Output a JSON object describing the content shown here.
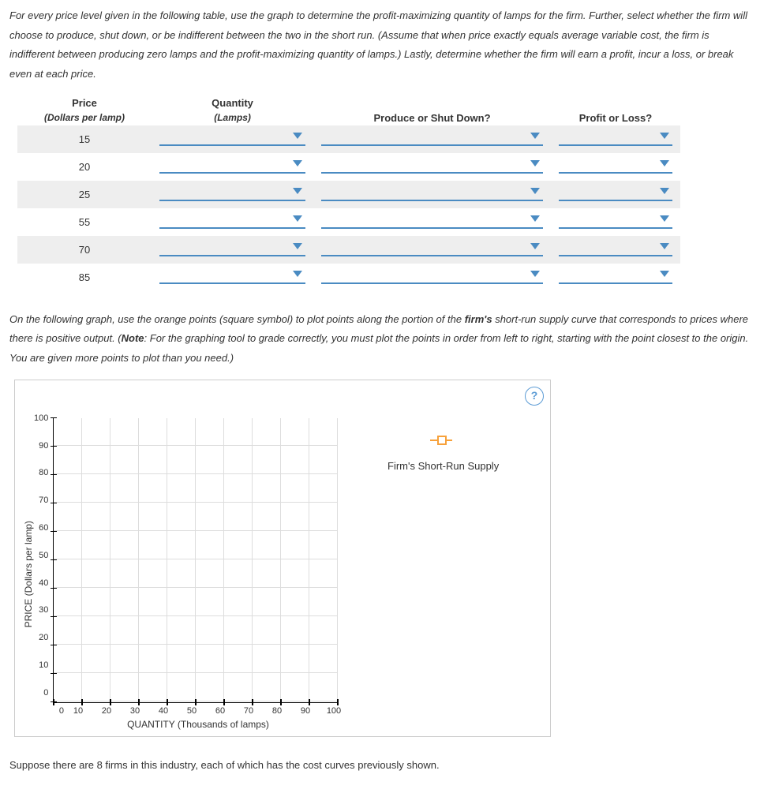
{
  "instruction_1": "For every price level given in the following table, use the graph to determine the profit-maximizing quantity of lamps for the firm. Further, select whether the firm will choose to produce, shut down, or be indifferent between the two in the short run. (Assume that when price exactly equals average variable cost, the firm is indifferent between producing zero lamps and the profit-maximizing quantity of lamps.) Lastly, determine whether the firm will earn a profit, incur a loss, or break even at each price.",
  "table": {
    "headers": {
      "price_title": "Price",
      "price_sub": "(Dollars per lamp)",
      "qty_title": "Quantity",
      "qty_sub": "(Lamps)",
      "produce": "Produce or Shut Down?",
      "profit": "Profit or Loss?"
    },
    "prices": [
      "15",
      "20",
      "25",
      "55",
      "70",
      "85"
    ]
  },
  "instruction_2_a": "On the following graph, use the orange points (square symbol) to plot points along the portion of the ",
  "instruction_2_bold": "firm's",
  "instruction_2_b": " short-run supply curve that corresponds to prices where there is positive output. (",
  "instruction_2_note_bold": "Note",
  "instruction_2_c": ": For the graphing tool to grade correctly, you must plot the points in order from left to right, starting with the point closest to the origin. You are given more points to plot than you need.)",
  "help_label": "?",
  "legend_label": "Firm's Short-Run Supply",
  "chart_data": {
    "type": "scatter",
    "title": "",
    "xlabel": "QUANTITY (Thousands of lamps)",
    "ylabel": "PRICE (Dollars per lamp)",
    "xlim": [
      0,
      100
    ],
    "ylim": [
      0,
      100
    ],
    "x_ticks": [
      "0",
      "10",
      "20",
      "30",
      "40",
      "50",
      "60",
      "70",
      "80",
      "90",
      "100"
    ],
    "y_ticks": [
      "100",
      "90",
      "80",
      "70",
      "60",
      "50",
      "40",
      "30",
      "20",
      "10",
      "0"
    ],
    "series": [
      {
        "name": "Firm's Short-Run Supply",
        "values": []
      }
    ]
  },
  "footer_text": "Suppose there are 8 firms in this industry, each of which has the cost curves previously shown."
}
